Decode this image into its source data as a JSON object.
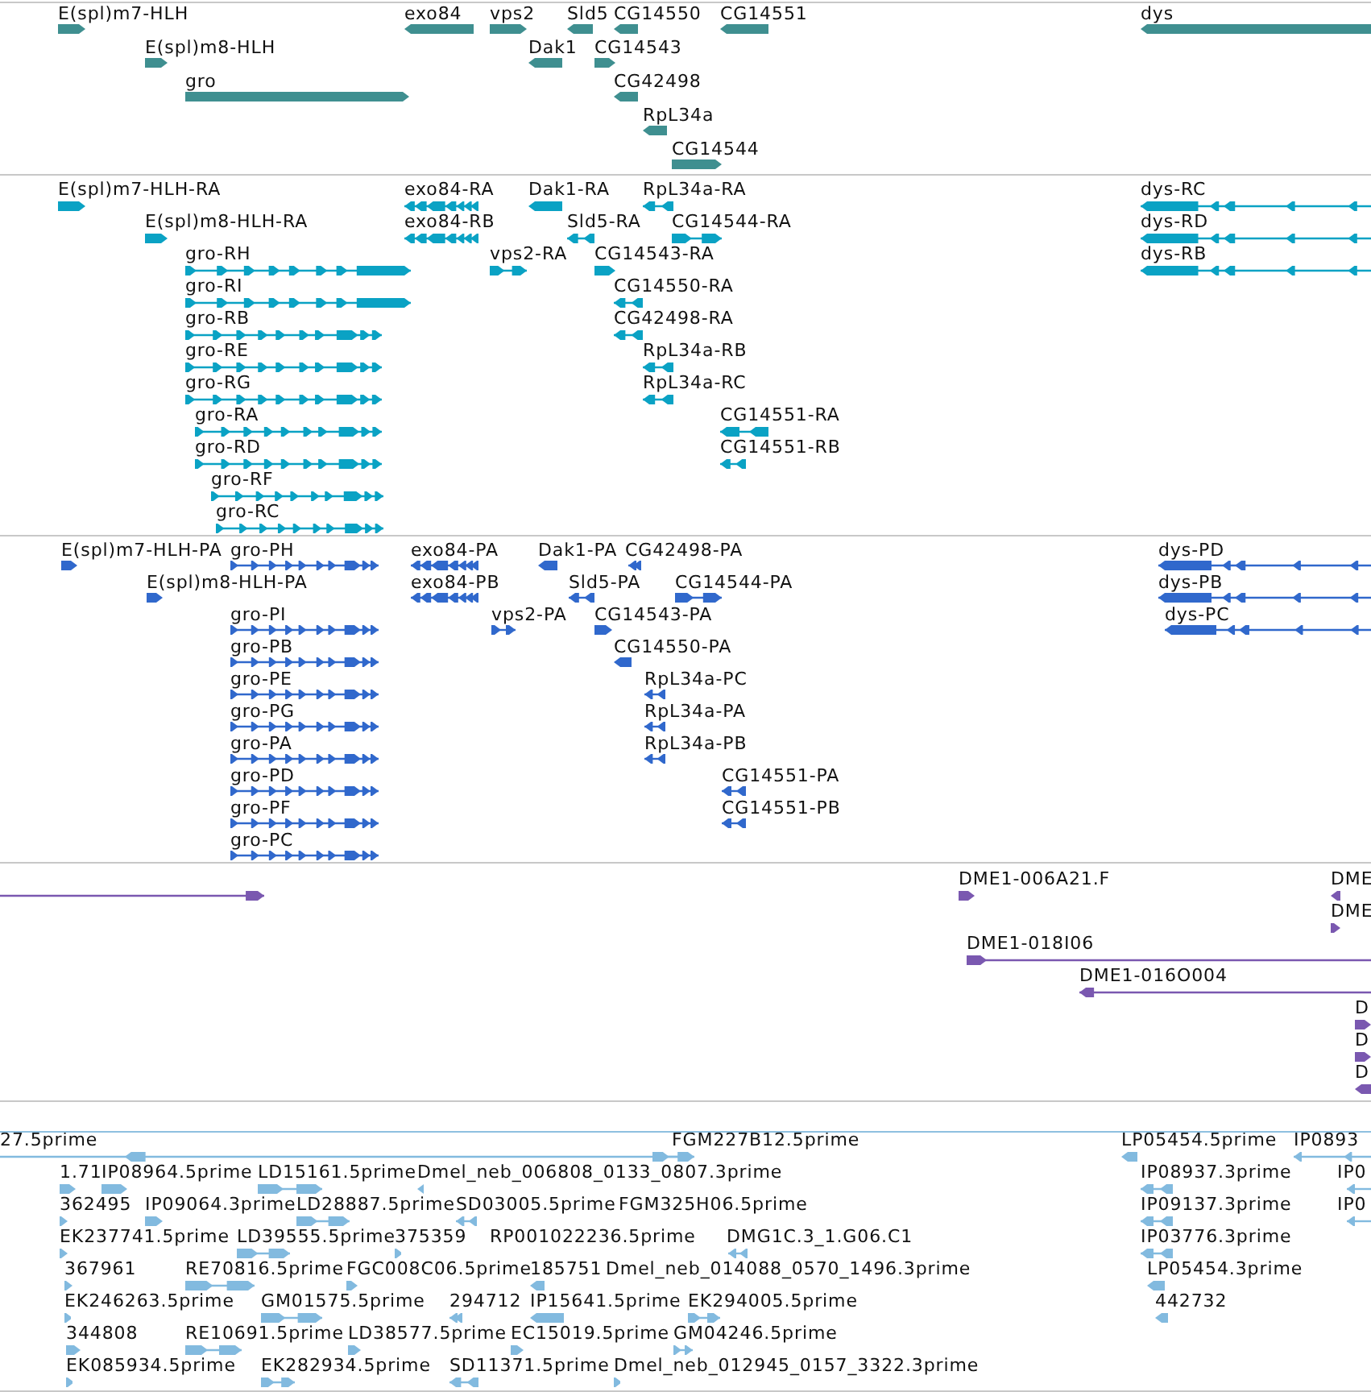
{
  "tracks": [
    {
      "kind": "gene",
      "features": [
        {
          "label": "E(spl)m7-HLH",
          "reverse": false
        },
        {
          "label": "exo84",
          "reverse": true
        },
        {
          "label": "vps2",
          "reverse": false
        },
        {
          "label": "Sld5",
          "reverse": true
        },
        {
          "label": "CG14550",
          "reverse": true
        },
        {
          "label": "CG14551",
          "reverse": true
        },
        {
          "label": "dys",
          "reverse": true
        },
        {
          "label": "E(spl)m8-HLH",
          "reverse": false
        },
        {
          "label": "Dak1",
          "reverse": true
        },
        {
          "label": "CG14543",
          "reverse": false
        },
        {
          "label": "gro",
          "reverse": false
        },
        {
          "label": "CG42498",
          "reverse": true
        },
        {
          "label": "RpL34a",
          "reverse": true
        },
        {
          "label": "CG14544",
          "reverse": false
        }
      ]
    },
    {
      "kind": "mrna",
      "features": [
        {
          "label": "E(spl)m7-HLH-RA",
          "reverse": false
        },
        {
          "label": "exo84-RA",
          "reverse": true
        },
        {
          "label": "Dak1-RA",
          "reverse": true
        },
        {
          "label": "RpL34a-RA",
          "reverse": true
        },
        {
          "label": "dys-RC",
          "reverse": true
        },
        {
          "label": "E(spl)m8-HLH-RA",
          "reverse": false
        },
        {
          "label": "exo84-RB",
          "reverse": true
        },
        {
          "label": "Sld5-RA",
          "reverse": true
        },
        {
          "label": "CG14544-RA",
          "reverse": false
        },
        {
          "label": "dys-RD",
          "reverse": true
        },
        {
          "label": "gro-RH",
          "reverse": false
        },
        {
          "label": "vps2-RA",
          "reverse": false
        },
        {
          "label": "CG14543-RA",
          "reverse": false
        },
        {
          "label": "dys-RB",
          "reverse": true
        },
        {
          "label": "gro-RI",
          "reverse": false
        },
        {
          "label": "CG14550-RA",
          "reverse": true
        },
        {
          "label": "gro-RB",
          "reverse": false
        },
        {
          "label": "CG42498-RA",
          "reverse": true
        },
        {
          "label": "gro-RE",
          "reverse": false
        },
        {
          "label": "RpL34a-RB",
          "reverse": true
        },
        {
          "label": "gro-RG",
          "reverse": false
        },
        {
          "label": "RpL34a-RC",
          "reverse": true
        },
        {
          "label": "gro-RA",
          "reverse": false
        },
        {
          "label": "CG14551-RA",
          "reverse": true
        },
        {
          "label": "gro-RD",
          "reverse": false
        },
        {
          "label": "CG14551-RB",
          "reverse": true
        },
        {
          "label": "gro-RF",
          "reverse": false
        },
        {
          "label": "gro-RC",
          "reverse": false
        }
      ]
    },
    {
      "kind": "protein",
      "features": [
        {
          "label": "E(spl)m7-HLH-PA",
          "reverse": false
        },
        {
          "label": "gro-PH",
          "reverse": false
        },
        {
          "label": "exo84-PA",
          "reverse": true
        },
        {
          "label": "Dak1-PA",
          "reverse": true
        },
        {
          "label": "CG42498-PA",
          "reverse": true
        },
        {
          "label": "dys-PD",
          "reverse": true
        },
        {
          "label": "E(spl)m8-HLH-PA",
          "reverse": false
        },
        {
          "label": "exo84-PB",
          "reverse": true
        },
        {
          "label": "Sld5-PA",
          "reverse": true
        },
        {
          "label": "CG14544-PA",
          "reverse": false
        },
        {
          "label": "dys-PB",
          "reverse": true
        },
        {
          "label": "gro-PI",
          "reverse": false
        },
        {
          "label": "vps2-PA",
          "reverse": false
        },
        {
          "label": "CG14543-PA",
          "reverse": false
        },
        {
          "label": "dys-PC",
          "reverse": true
        },
        {
          "label": "gro-PB",
          "reverse": false
        },
        {
          "label": "CG14550-PA",
          "reverse": true
        },
        {
          "label": "gro-PE",
          "reverse": false
        },
        {
          "label": "RpL34a-PC",
          "reverse": true
        },
        {
          "label": "gro-PG",
          "reverse": false
        },
        {
          "label": "RpL34a-PA",
          "reverse": true
        },
        {
          "label": "gro-PA",
          "reverse": false
        },
        {
          "label": "RpL34a-PB",
          "reverse": true
        },
        {
          "label": "gro-PD",
          "reverse": false
        },
        {
          "label": "CG14551-PA",
          "reverse": true
        },
        {
          "label": "gro-PF",
          "reverse": false
        },
        {
          "label": "CG14551-PB",
          "reverse": true
        },
        {
          "label": "gro-PC",
          "reverse": false
        }
      ]
    },
    {
      "kind": "clone",
      "features": [
        {
          "reverse": false
        },
        {
          "label": "DME1-006A21.F",
          "reverse": false
        },
        {
          "label": "DME",
          "reverse": true
        },
        {
          "label": "DME",
          "reverse": false
        },
        {
          "label": "DME1-018I06",
          "reverse": false
        },
        {
          "label": "DME1-016O004",
          "reverse": true
        },
        {
          "label": "D",
          "reverse": false
        },
        {
          "label": "D",
          "reverse": false
        },
        {
          "label": "D",
          "reverse": true
        }
      ]
    },
    {
      "kind": "est",
      "features": [
        {
          "label": "27.5prime",
          "reverse": true
        },
        {
          "label": "FGM227B12.5prime",
          "reverse": false
        },
        {
          "label": "LP05454.5prime",
          "reverse": true
        },
        {
          "label": "IP0893",
          "reverse": true
        },
        {
          "label": "1.71",
          "reverse": false
        },
        {
          "label": "IP08964.5prime",
          "reverse": false
        },
        {
          "label": "LD15161.5prime",
          "reverse": false
        },
        {
          "label": "Dmel_neb_006808_0133_0807.3prime",
          "reverse": true
        },
        {
          "label": "IP08937.3prime",
          "reverse": true
        },
        {
          "label": "IP0",
          "reverse": true
        },
        {
          "label": "362495",
          "reverse": false
        },
        {
          "label": "IP09064.3prime",
          "reverse": false
        },
        {
          "label": "LD28887.5prime",
          "reverse": false
        },
        {
          "label": "SD03005.5prime",
          "reverse": true
        },
        {
          "label": "FGM325H06.5prime"
        },
        {
          "label": "IP09137.3prime",
          "reverse": true
        },
        {
          "label": "IP0",
          "reverse": true
        },
        {
          "label": "EK237741.5prime",
          "reverse": false
        },
        {
          "label": "LD39555.5prime",
          "reverse": false
        },
        {
          "label": "375359",
          "reverse": false
        },
        {
          "label": "RP001022236.5prime"
        },
        {
          "label": "DMG1C.3_1.G06.C1",
          "reverse": true
        },
        {
          "label": "IP03776.3prime",
          "reverse": true
        },
        {
          "label": "367961",
          "reverse": false
        },
        {
          "label": "RE70816.5prime",
          "reverse": false
        },
        {
          "label": "FGC008C06.5prime",
          "reverse": false
        },
        {
          "label": "185751",
          "reverse": true
        },
        {
          "label": "Dmel_neb_014088_0570_1496.3prime"
        },
        {
          "label": "LP05454.3prime",
          "reverse": true
        },
        {
          "label": "EK246263.5prime",
          "reverse": false
        },
        {
          "label": "GM01575.5prime",
          "reverse": false
        },
        {
          "label": "294712",
          "reverse": true
        },
        {
          "label": "IP15641.5prime",
          "reverse": true
        },
        {
          "label": "EK294005.5prime",
          "reverse": false
        },
        {
          "label": "442732",
          "reverse": true
        },
        {
          "label": "344808",
          "reverse": false
        },
        {
          "label": "RE10691.5prime",
          "reverse": false
        },
        {
          "label": "LD38577.5prime",
          "reverse": false
        },
        {
          "label": "EC15019.5prime",
          "reverse": false
        },
        {
          "label": "GM04246.5prime",
          "reverse": false
        },
        {
          "label": "EK085934.5prime",
          "reverse": false
        },
        {
          "label": "EK282934.5prime",
          "reverse": false
        },
        {
          "label": "SD11371.5prime",
          "reverse": true
        },
        {
          "label": "Dmel_neb_012945_0157_3322.3prime",
          "reverse": false
        }
      ]
    }
  ]
}
